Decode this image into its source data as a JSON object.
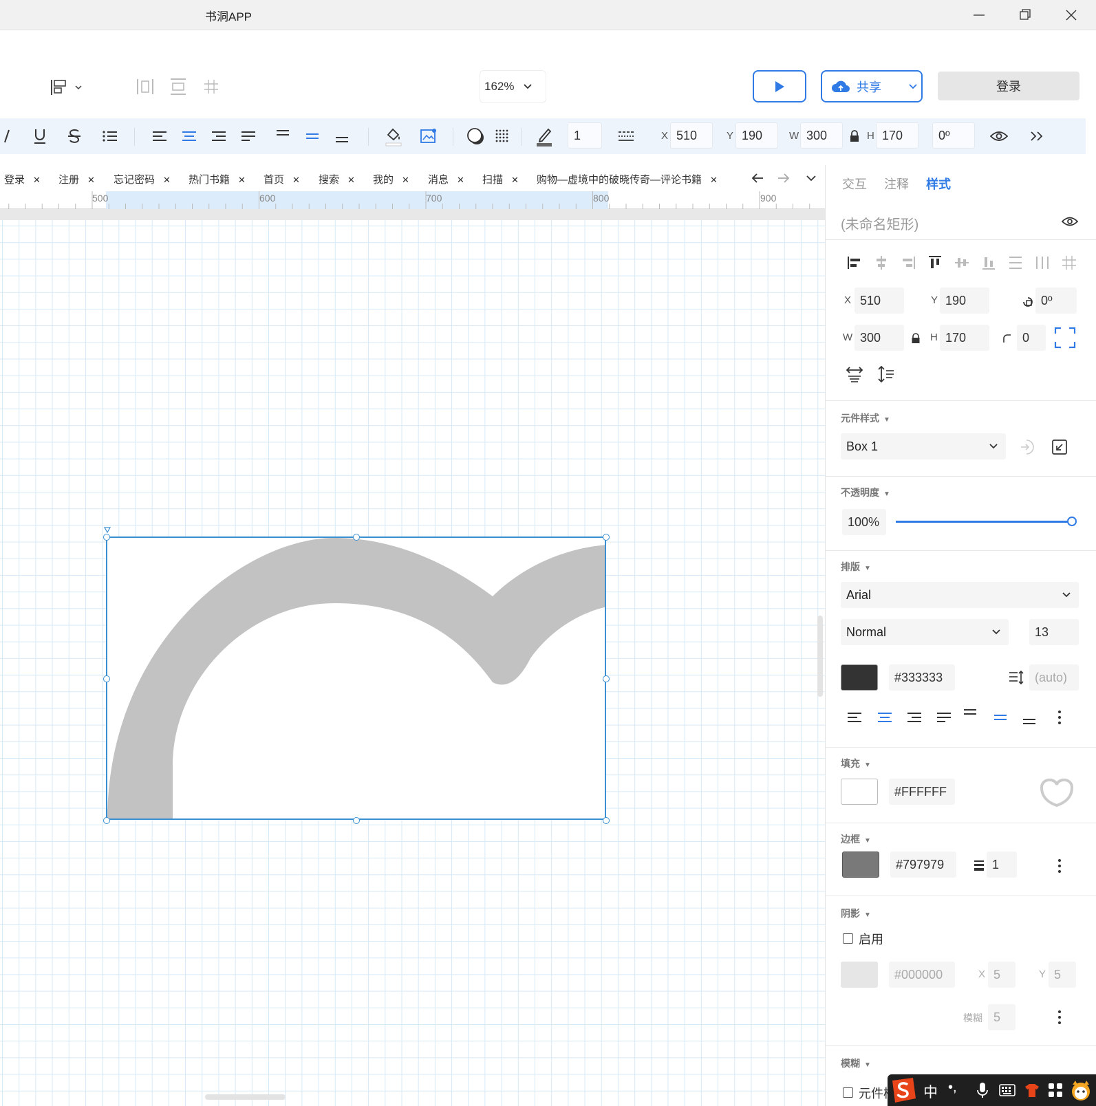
{
  "titlebar": {
    "title": "书洞APP"
  },
  "header": {
    "zoom": "162%",
    "share_label": "共享",
    "login_label": "登录"
  },
  "format_toolbar": {
    "stroke_width": "1",
    "x_label": "X",
    "x_value": "510",
    "y_label": "Y",
    "y_value": "190",
    "w_label": "W",
    "w_value": "300",
    "h_label": "H",
    "h_value": "170",
    "rotation": "0º"
  },
  "tabs": [
    {
      "label": "登录"
    },
    {
      "label": "注册"
    },
    {
      "label": "忘记密码"
    },
    {
      "label": "热门书籍"
    },
    {
      "label": "首页"
    },
    {
      "label": "搜索"
    },
    {
      "label": "我的"
    },
    {
      "label": "消息"
    },
    {
      "label": "扫描"
    },
    {
      "label": "购物—虚境中的破晓传奇—评论书籍"
    }
  ],
  "ruler": {
    "labels": [
      "500",
      "600",
      "700",
      "800",
      "900"
    ]
  },
  "panel": {
    "tabs": [
      {
        "label": "交互"
      },
      {
        "label": "注释"
      },
      {
        "label": "样式"
      }
    ],
    "active_tab": "样式",
    "element_name": "(未命名矩形)",
    "x_label": "X",
    "x_value": "510",
    "y_label": "Y",
    "y_value": "190",
    "rotation": "0º",
    "w_label": "W",
    "w_value": "300",
    "h_label": "H",
    "h_value": "170",
    "radius": "0",
    "widget_style": {
      "title": "元件样式",
      "value": "Box 1"
    },
    "opacity": {
      "title": "不透明度",
      "value": "100%",
      "level": 1.0
    },
    "typography": {
      "title": "排版",
      "font": "Arial",
      "weight": "Normal",
      "size": "13",
      "color": "#333333",
      "line_height": "(auto)"
    },
    "fill": {
      "title": "填充",
      "color": "#FFFFFF"
    },
    "border": {
      "title": "边框",
      "color": "#797979",
      "width": "1"
    },
    "shadow": {
      "title": "阴影",
      "enable_label": "启用",
      "color": "#000000",
      "x_label": "X",
      "x": "5",
      "y_label": "Y",
      "y": "5",
      "blur_label": "模糊",
      "blur": "5"
    },
    "blur": {
      "title": "模糊",
      "option_label": "元件模糊"
    }
  },
  "colors": {
    "accent": "#2f7ae5",
    "selection": "#3a8fd1",
    "text_color_swatch": "#333333",
    "border_swatch": "#797979",
    "shadow_swatch": "#e6e6e6"
  },
  "ime": {
    "char": "中",
    "punct": "•,"
  }
}
